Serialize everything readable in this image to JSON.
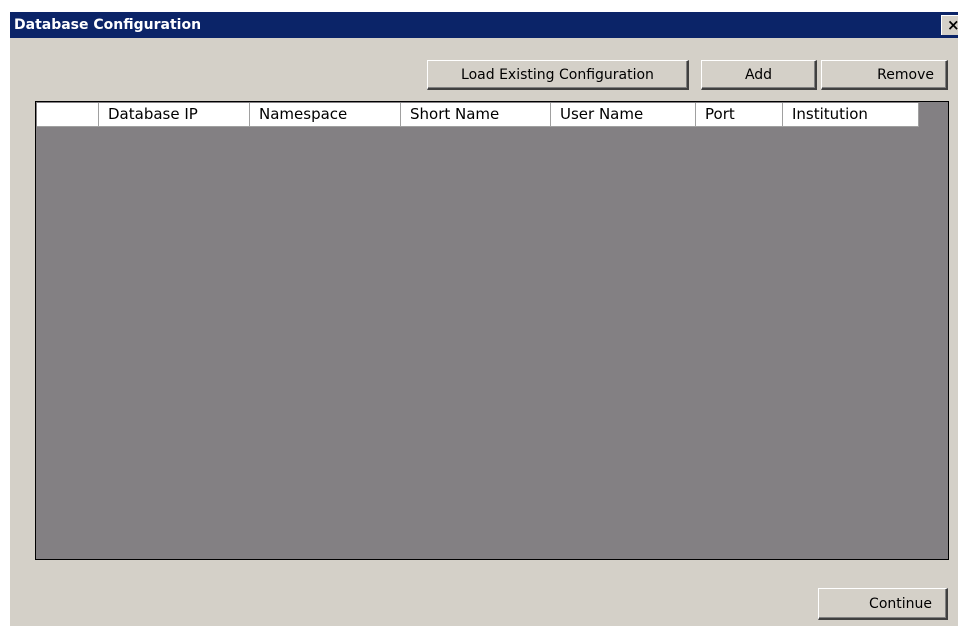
{
  "window": {
    "title": "Database Configuration",
    "close_glyph": "✕"
  },
  "toolbar": {
    "load_label": "Load Existing Configuration",
    "add_label": "Add",
    "remove_label": "Remove"
  },
  "grid": {
    "columns": [
      "",
      "Database IP",
      "Namespace",
      "Short Name",
      "User Name",
      "Port",
      "Institution"
    ],
    "rows": []
  },
  "footer": {
    "continue_label": "Continue"
  },
  "colors": {
    "title_bar": "#0b2468",
    "window_bg": "#d4d0c8",
    "grid_bg": "#838083"
  }
}
